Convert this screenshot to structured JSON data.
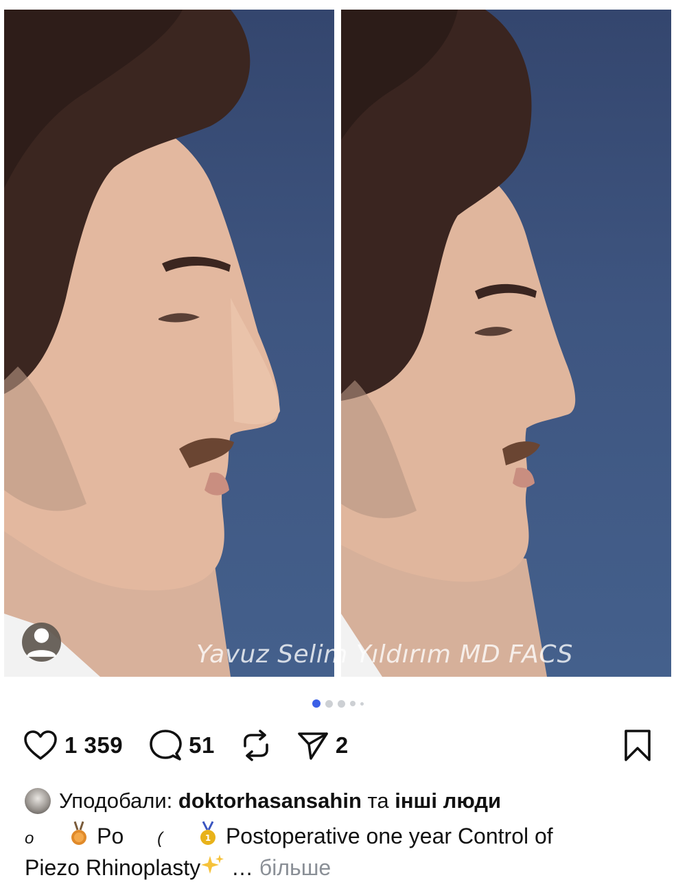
{
  "post": {
    "watermark": "Yavuz Selim Yıldırım MD FACS",
    "carousel": {
      "total": 5,
      "active": 1
    }
  },
  "actions": {
    "likes": "1 359",
    "comments": "51",
    "shares": "2",
    "icons": [
      "heart-icon",
      "comment-icon",
      "repost-icon",
      "send-icon",
      "bookmark-icon"
    ]
  },
  "liked_by": {
    "prefix": "Уподобали: ",
    "user": "doktorhasansahin",
    "connector": " та ",
    "others": "інші люди"
  },
  "caption": {
    "line1_a": "o",
    "line1_b": "Po",
    "line1_c": "(",
    "line1_text": "Postoperative one year Control of",
    "line2_text": "Piezo Rhinoplasty",
    "ellipsis": " … ",
    "more": "більше"
  },
  "colors": {
    "accent": "#3b5fe6",
    "muted": "#8a8f96",
    "background": "#ffffff"
  }
}
